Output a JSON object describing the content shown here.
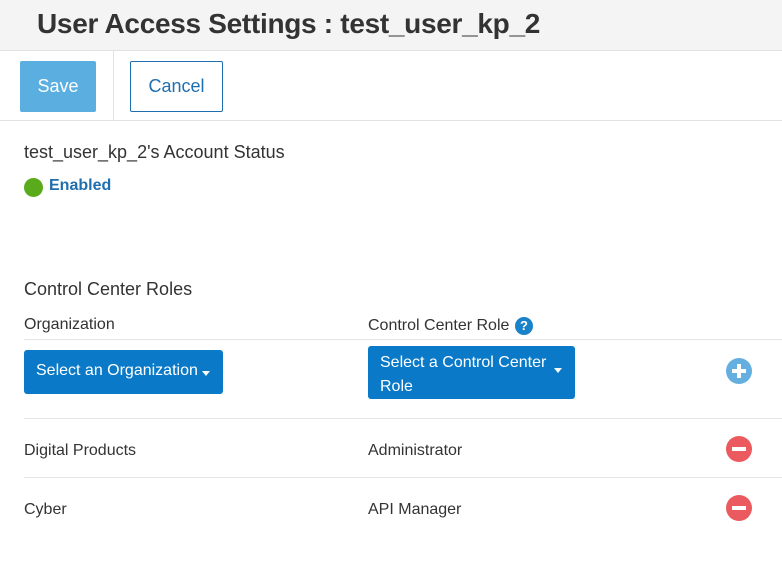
{
  "header": {
    "title": "User Access Settings : test_user_kp_2"
  },
  "toolbar": {
    "save_label": "Save",
    "cancel_label": "Cancel"
  },
  "account_status": {
    "title": "test_user_kp_2's Account Status",
    "status": "Enabled",
    "status_color": "#5aab1c"
  },
  "roles": {
    "title": "Control Center Roles",
    "columns": {
      "organization": "Organization",
      "role": "Control Center Role"
    },
    "help_icon": "question-circle-icon",
    "organization_select": "Select an Organization",
    "role_select": "Select a Control Center Role",
    "add_icon": "plus-circle-icon",
    "remove_icon": "minus-circle-icon",
    "rows": [
      {
        "organization": "Digital Products",
        "role": "Administrator"
      },
      {
        "organization": "Cyber",
        "role": "API Manager"
      }
    ]
  },
  "colors": {
    "primary": "#0a7ac8",
    "save_button": "#5aaee0",
    "remove_button": "#ea5a5e",
    "add_button": "#64aee0"
  }
}
